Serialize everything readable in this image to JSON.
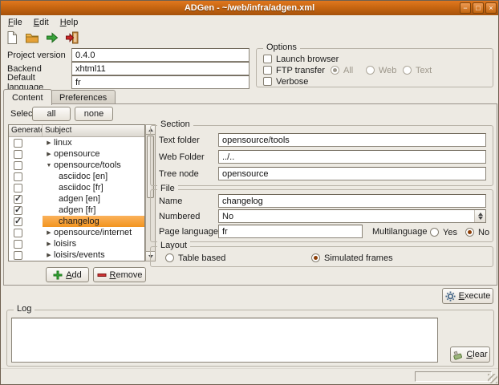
{
  "window": {
    "title": "ADGen - ~/web/infra/adgen.xml",
    "controls": {
      "minimize": "−",
      "maximize": "□",
      "close": "×"
    }
  },
  "menubar": {
    "items": [
      {
        "label": "File"
      },
      {
        "label": "Edit"
      },
      {
        "label": "Help"
      }
    ]
  },
  "toolbar": {
    "icons": [
      {
        "name": "new-document-icon"
      },
      {
        "name": "open-folder-icon"
      },
      {
        "name": "generate-icon"
      },
      {
        "name": "quit-icon"
      }
    ]
  },
  "form": {
    "project_version": {
      "label": "Project version",
      "value": "0.4.0"
    },
    "backend": {
      "label": "Backend",
      "value": "xhtml11"
    },
    "default_language": {
      "label": "Default language",
      "value": "fr"
    }
  },
  "options": {
    "title": "Options",
    "launch_browser": {
      "label": "Launch browser",
      "checked": false
    },
    "ftp_transfer": {
      "label": "FTP transfer",
      "checked": false
    },
    "verbose": {
      "label": "Verbose",
      "checked": false
    },
    "scope": [
      {
        "label": "All",
        "selected": true,
        "disabled": true
      },
      {
        "label": "Web",
        "selected": false,
        "disabled": true
      },
      {
        "label": "Text",
        "selected": false,
        "disabled": true
      }
    ]
  },
  "tabs": [
    {
      "label": "Content",
      "active": true
    },
    {
      "label": "Preferences",
      "active": false
    }
  ],
  "content": {
    "select": {
      "label": "Select",
      "all": "all",
      "none": "none"
    },
    "tree": {
      "columns": [
        "Generate",
        "Subject"
      ],
      "rows": [
        {
          "checked": false,
          "glyph": "▶",
          "label": "linux",
          "level": 0,
          "selected": false
        },
        {
          "checked": false,
          "glyph": "▶",
          "label": "opensource",
          "level": 0,
          "selected": false
        },
        {
          "checked": false,
          "glyph": "▼",
          "label": "opensource/tools",
          "level": 0,
          "selected": false
        },
        {
          "checked": false,
          "glyph": "",
          "label": "asciidoc [en]",
          "level": 1,
          "selected": false
        },
        {
          "checked": false,
          "glyph": "",
          "label": "asciidoc [fr]",
          "level": 1,
          "selected": false
        },
        {
          "checked": true,
          "glyph": "",
          "label": "adgen [en]",
          "level": 1,
          "selected": false
        },
        {
          "checked": true,
          "glyph": "",
          "label": "adgen [fr]",
          "level": 1,
          "selected": false
        },
        {
          "checked": true,
          "glyph": "",
          "label": "changelog",
          "level": 1,
          "selected": true
        },
        {
          "checked": false,
          "glyph": "▶",
          "label": "opensource/internet",
          "level": 0,
          "selected": false
        },
        {
          "checked": false,
          "glyph": "▶",
          "label": "loisirs",
          "level": 0,
          "selected": false
        },
        {
          "checked": false,
          "glyph": "▶",
          "label": "loisirs/events",
          "level": 0,
          "selected": false
        }
      ]
    },
    "add_button": "Add",
    "remove_button": "Remove",
    "section": {
      "title": "Section",
      "text_folder": {
        "label": "Text folder",
        "value": "opensource/tools"
      },
      "web_folder": {
        "label": "Web Folder",
        "value": "../.."
      },
      "tree_node": {
        "label": "Tree node",
        "value": "opensource"
      }
    },
    "file": {
      "title": "File",
      "name": {
        "label": "Name",
        "value": "changelog"
      },
      "numbered": {
        "label": "Numbered",
        "value": "No"
      },
      "page_language": {
        "label": "Page language",
        "value": "fr"
      },
      "multilanguage": {
        "label": "Multilanguage",
        "yes": {
          "label": "Yes",
          "selected": false
        },
        "no": {
          "label": "No",
          "selected": true
        }
      }
    },
    "layout": {
      "title": "Layout",
      "table_based": {
        "label": "Table based",
        "selected": false
      },
      "simulated_frames": {
        "label": "Simulated frames",
        "selected": true
      }
    }
  },
  "execute_button": "Execute",
  "log": {
    "title": "Log",
    "content": ""
  },
  "clear_button": "Clear",
  "colors": {
    "accent": "#E0771E",
    "selection": "#F2941F",
    "radio_dot": "#8C3E06"
  }
}
